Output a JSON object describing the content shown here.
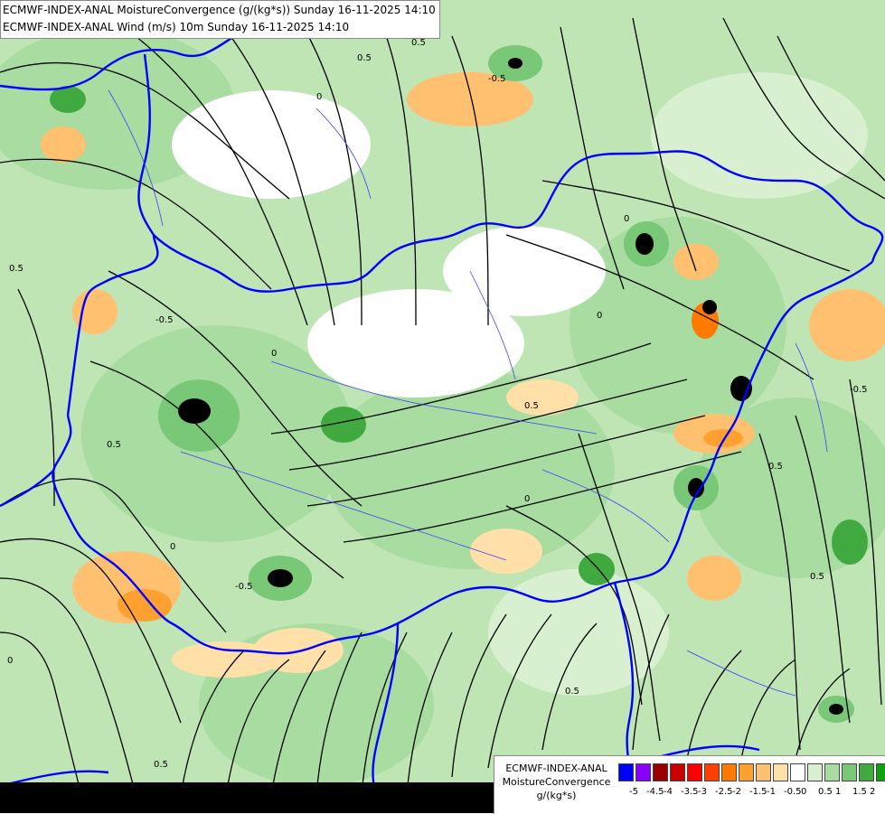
{
  "header": {
    "line1": "ECMWF-INDEX-ANAL MoistureConvergence (g/(kg*s)) Sunday 16-11-2025 14:10",
    "line2": "ECMWF-INDEX-ANAL Wind (m/s) 10m Sunday 16-11-2025 14:10"
  },
  "legend": {
    "title_line1": "ECMWF-INDEX-ANAL",
    "title_line2": "MoistureConvergence",
    "title_line3": "g/(kg*s)",
    "colors": [
      "#0000ff",
      "#8a00ff",
      "#9a0000",
      "#c80000",
      "#ff0000",
      "#ff4000",
      "#ff7a00",
      "#ffa030",
      "#ffc070",
      "#ffe0a8",
      "#ffffff",
      "#d8f0d0",
      "#a8dca0",
      "#78c878",
      "#40aa40",
      "#10a010"
    ],
    "tick_labels": [
      "-5",
      "-4.5",
      "-4",
      "-3.5",
      "-3",
      "-2.5",
      "-2",
      "-1.5",
      "-1",
      "-0.5",
      "0",
      "0.5",
      "1",
      "1.5",
      "2"
    ]
  },
  "map_labels": {
    "contour_values": [
      "0.5",
      "-0.5",
      "0",
      "0",
      "0.5",
      "-0.5",
      "0.5",
      "0",
      "0.5",
      "-0.5",
      "0",
      "0.5",
      "0.5",
      "-0.5",
      "0",
      "0.5",
      "0.5",
      "0",
      "0.5",
      "0"
    ]
  },
  "colors": {
    "border": "#0000ff",
    "river": "#4040ff",
    "streamline": "#000000",
    "land_green": "#a8dca0",
    "orange": "#ffc070"
  }
}
